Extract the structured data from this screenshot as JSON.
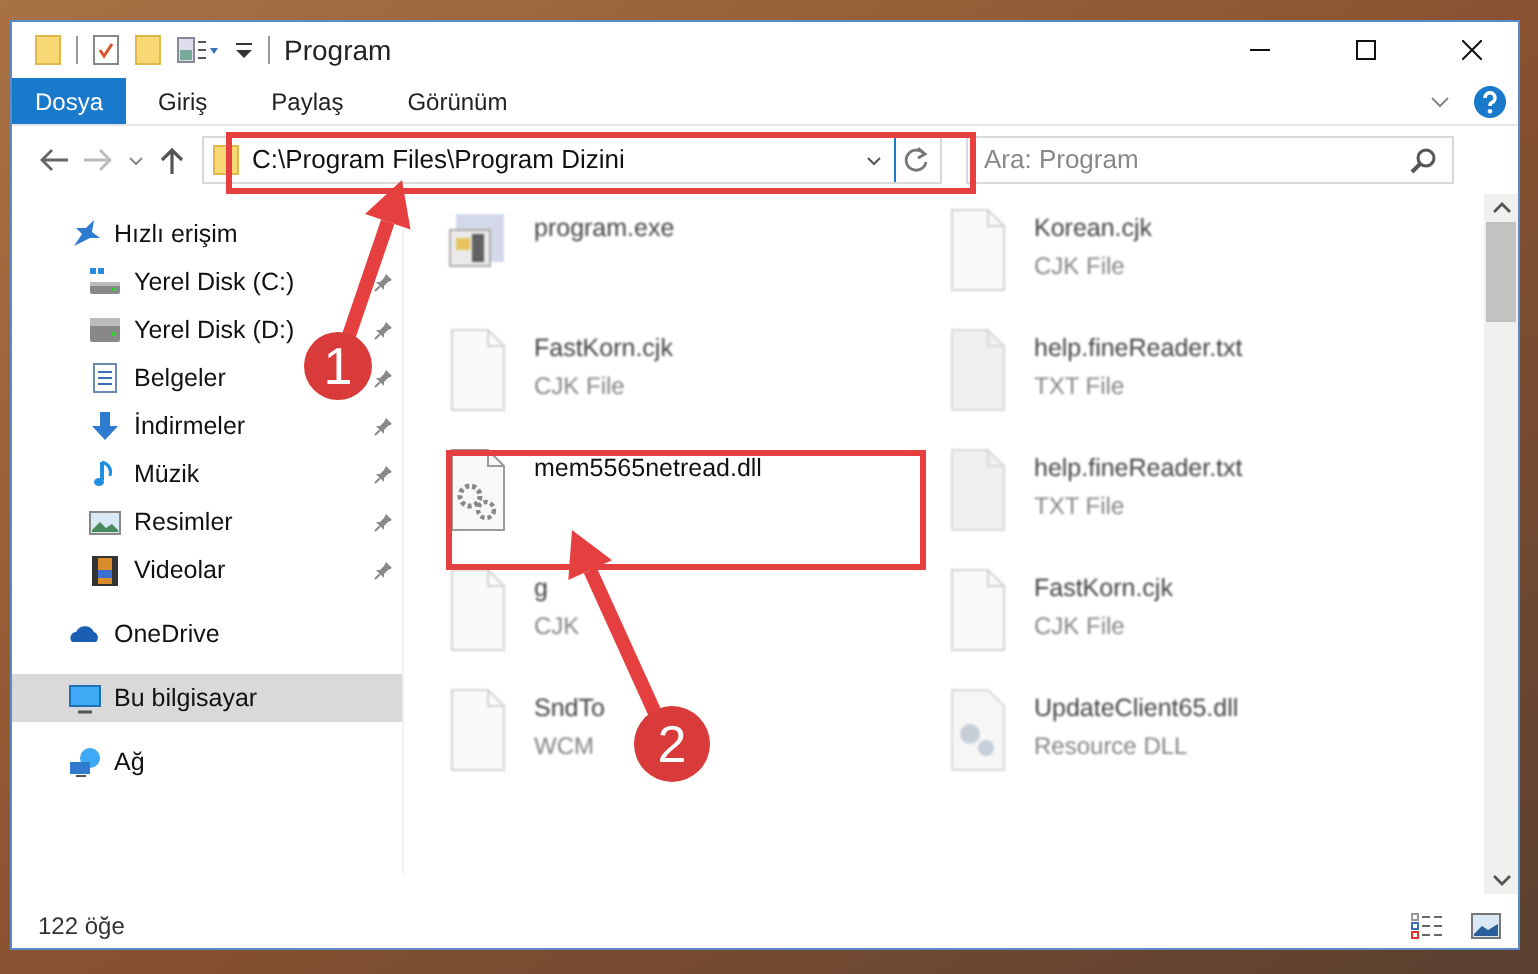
{
  "window": {
    "title": "Program"
  },
  "ribbon_tabs": [
    {
      "label": "Dosya",
      "kind": "file",
      "selected": false
    },
    {
      "label": "Giriş",
      "kind": "tab",
      "selected": false
    },
    {
      "label": "Paylaş",
      "kind": "tab",
      "selected": false
    },
    {
      "label": "Görünüm",
      "kind": "tab",
      "selected": false
    }
  ],
  "address_bar": {
    "path": "C:\\Program Files\\Program Dizini"
  },
  "search": {
    "placeholder": "Ara: Program"
  },
  "sidebar": {
    "items": [
      {
        "label": "Hızlı erişim",
        "kind": "star",
        "selected": false,
        "children": [
          {
            "label": "Yerel Disk (C:)",
            "kind": "drive-c",
            "pinned": true,
            "selected": false
          },
          {
            "label": "Yerel Disk (D:)",
            "kind": "drive",
            "pinned": true,
            "selected": false
          },
          {
            "label": "Belgeler",
            "kind": "document",
            "pinned": true,
            "selected": false
          },
          {
            "label": "İndirmeler",
            "kind": "download",
            "pinned": true,
            "selected": false
          },
          {
            "label": "Müzik",
            "kind": "music",
            "pinned": true,
            "selected": false
          },
          {
            "label": "Resimler",
            "kind": "pictures",
            "pinned": true,
            "selected": false
          },
          {
            "label": "Videolar",
            "kind": "video",
            "pinned": true,
            "selected": false
          }
        ]
      },
      {
        "label": "OneDrive",
        "kind": "cloud",
        "selected": false
      },
      {
        "label": "Bu bilgisayar",
        "kind": "computer",
        "selected": true
      },
      {
        "label": "Ağ",
        "kind": "network",
        "selected": false
      }
    ]
  },
  "files": [
    {
      "name": "program.exe",
      "kind": "exe",
      "blurred": true
    },
    {
      "name": "Korean.cjk",
      "type": "CJK File",
      "kind": "blank",
      "blurred": true
    },
    {
      "name": "FastKorn.cjk",
      "type": "CJK File",
      "kind": "blank",
      "blurred": true
    },
    {
      "name": "help.fineReader.txt",
      "type": "TXT File",
      "kind": "gray",
      "blurred": true
    },
    {
      "name": "mem5565netread.dll",
      "kind": "gears",
      "blurred": false
    },
    {
      "name": "help.fineReader.txt",
      "type": "TXT File",
      "kind": "gray",
      "blurred": true
    },
    {
      "name": "g",
      "type": "CJK",
      "kind": "blank",
      "blurred": true
    },
    {
      "name": "FastKorn.cjk",
      "type": "CJK File",
      "kind": "blank",
      "blurred": true
    },
    {
      "name": "SndTo",
      "type": "WCM",
      "kind": "blank",
      "blurred": true
    },
    {
      "name": "UpdateClient65.dll",
      "type": "Resource DLL",
      "kind": "resource",
      "blurred": true
    }
  ],
  "status_bar": {
    "count": "122 öğe"
  },
  "annotations": {
    "badges": [
      {
        "number": "1"
      },
      {
        "number": "2"
      }
    ]
  }
}
